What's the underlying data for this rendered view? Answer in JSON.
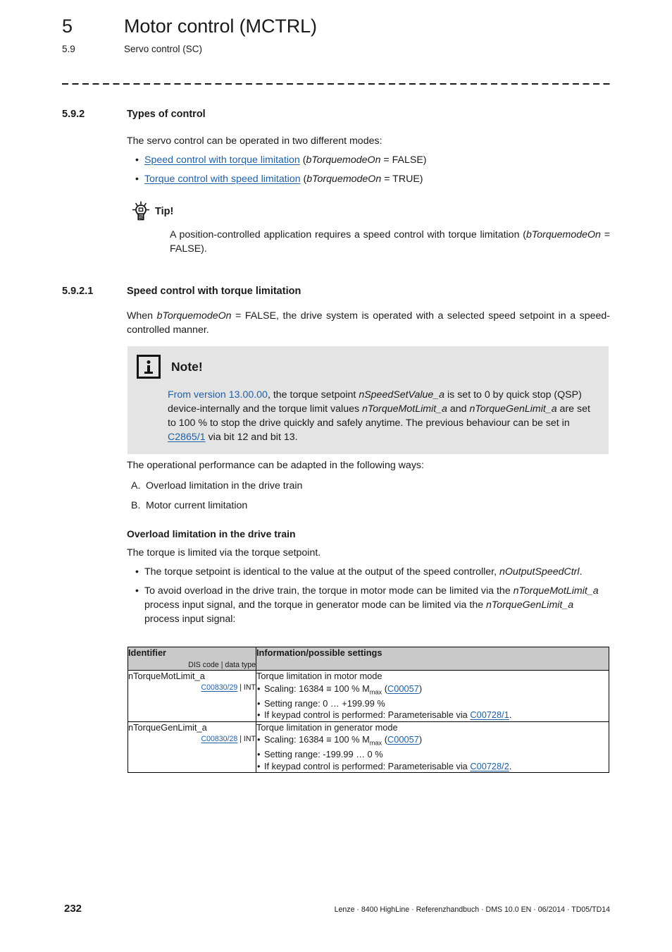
{
  "header": {
    "chapter_number": "5",
    "chapter_title": "Motor control (MCTRL)",
    "section_number": "5.9",
    "section_title": "Servo control (SC)"
  },
  "section_5_9_2": {
    "number": "5.9.2",
    "title": "Types of control",
    "intro": "The servo control can be operated in two different modes:",
    "modes": [
      {
        "link": "Speed control with torque limitation",
        "suffix_open": " (",
        "variable": "bTorquemodeOn",
        "suffix_close": " = FALSE)"
      },
      {
        "link": "Torque control with speed limitation",
        "suffix_open": " (",
        "variable": "bTorquemodeOn",
        "suffix_close": " = TRUE)"
      }
    ]
  },
  "tip": {
    "icon": "lightbulb-icon",
    "label": "Tip!",
    "text_part1": "A position-controlled application requires a speed control with torque limitation (",
    "text_variable": "bTorquemodeOn",
    "text_part2": " = FALSE)."
  },
  "section_5_9_2_1": {
    "number": "5.9.2.1",
    "title": "Speed control with torque limitation",
    "paragraph_part1": "When ",
    "paragraph_variable": "bTorquemodeOn",
    "paragraph_part2": " = FALSE, the drive system is operated with a selected speed setpoint in a speed-controlled manner."
  },
  "note": {
    "icon": "info-icon",
    "label": "Note!",
    "version_text": "From version 13.00.00",
    "t1": ", the torque setpoint ",
    "v1": "nSpeedSetValue_a",
    "t2": " is set to 0 by quick stop (QSP) device-internally and the torque limit values ",
    "v2": "nTorqueMotLimit_a",
    "t3": " and ",
    "v3": "nTorqueGenLimit_a",
    "t4": " are set to 100 % to stop the drive quickly and safely anytime. The previous behaviour can be set in ",
    "link": "C2865/1",
    "t5": " via bit 12 and bit 13."
  },
  "operational": {
    "intro": "The operational performance can be adapted in the following ways:",
    "items": [
      {
        "marker": "A.",
        "text": "Overload limitation in the drive train"
      },
      {
        "marker": "B.",
        "text": "Motor current limitation"
      }
    ]
  },
  "overload": {
    "heading": "Overload limitation in the drive train",
    "intro": "The torque is limited via the torque setpoint.",
    "bullets": [
      {
        "t1": "The torque setpoint is identical to the value at the output of the speed controller, ",
        "v1": "nOutputSpeedCtrl",
        "t2": "."
      },
      {
        "t1": "To avoid overload in the drive train, the torque in motor mode can be limited via the ",
        "v1": "nTorqueMotLimit_a",
        "t2": " process input signal, and the torque in generator mode can be limited via the ",
        "v2": "nTorqueGenLimit_a",
        "t3": " process input signal:"
      }
    ]
  },
  "table": {
    "columns": {
      "identifier_main": "Identifier",
      "identifier_sub": "DIS code | data type",
      "information": "Information/possible settings"
    },
    "rows": [
      {
        "identifier": "nTorqueMotLimit_a",
        "dis_code": "C00830/29",
        "data_type": "INT",
        "lead": "Torque limitation in motor mode",
        "scaling_prefix": "Scaling: 16384 ",
        "scaling_equiv": "≡",
        "scaling_mid": " 100 % M",
        "scaling_sub": "max",
        "scaling_paren_open": " (",
        "scaling_link": "C00057",
        "scaling_paren_close": ")",
        "setting_range": "Setting range: 0 … +199.99 %",
        "keypad_prefix": "If keypad control is performed: Parameterisable via ",
        "keypad_link": "C00728/1",
        "keypad_suffix": "."
      },
      {
        "identifier": "nTorqueGenLimit_a",
        "dis_code": "C00830/28",
        "data_type": "INT",
        "lead": "Torque limitation in generator mode",
        "scaling_prefix": "Scaling: 16384 ",
        "scaling_equiv": "≡",
        "scaling_mid": " 100 % M",
        "scaling_sub": "max",
        "scaling_paren_open": " (",
        "scaling_link": "C00057",
        "scaling_paren_close": ")",
        "setting_range": "Setting range: -199.99 … 0 %",
        "keypad_prefix": "If keypad control is performed: Parameterisable via ",
        "keypad_link": "C00728/2",
        "keypad_suffix": "."
      }
    ]
  },
  "footer": {
    "page_number": "232",
    "meta": "Lenze · 8400 HighLine · Referenzhandbuch · DMS 10.0 EN · 06/2014 · TD05/TD14"
  },
  "colors": {
    "link": "#1f5fa8",
    "note_background": "#e4e4e4",
    "table_header_background": "#c9c9c9",
    "text": "#1a1a1a"
  }
}
